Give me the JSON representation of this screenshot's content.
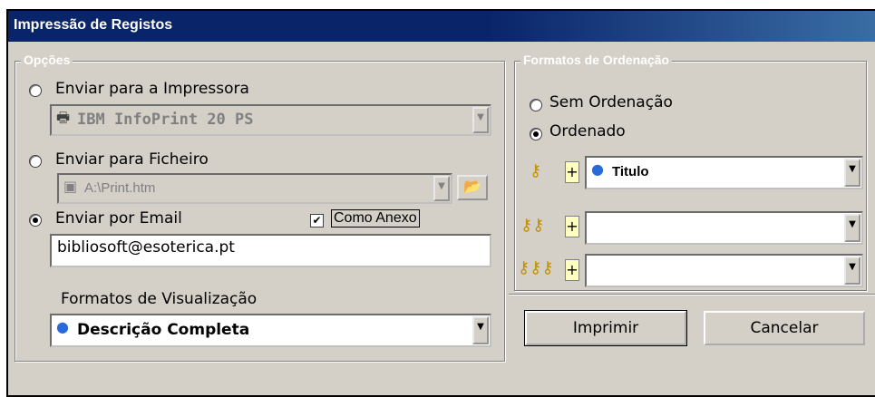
{
  "window": {
    "title": "Impressão de Registos"
  },
  "options": {
    "legend": "Opções",
    "send_printer_label": "Enviar para a Impressora",
    "printer_value": "IBM InfoPrint 20 PS",
    "send_file_label": "Enviar para Ficheiro",
    "file_value": "A:\\Print.htm",
    "send_email_label": "Enviar por Email",
    "attachment_label": "Como Anexo",
    "email_value": "bibliosoft@esoterica.pt",
    "view_formats_label": "Formatos de Visualização",
    "view_format_value": "Descrição Completa"
  },
  "sorting": {
    "legend": "Formatos de Ordenação",
    "no_sort_label": "Sem Ordenação",
    "sorted_label": "Ordenado",
    "sort1_value": "Titulo",
    "sort2_value": "",
    "sort3_value": "",
    "plus_label": "+"
  },
  "buttons": {
    "print_label": "Imprimir",
    "cancel_label": "Cancelar"
  },
  "icons": {
    "printer": "printer-icon",
    "file": "file-icon",
    "folder": "folder-icon",
    "globe": "globe-icon",
    "key": "key-icon"
  }
}
